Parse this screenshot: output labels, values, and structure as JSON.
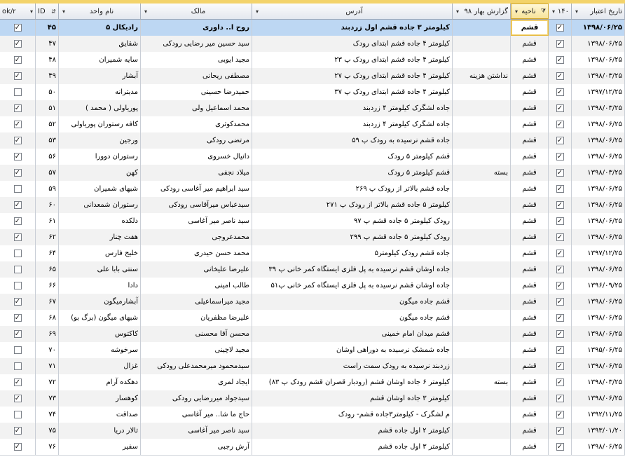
{
  "columns": {
    "ok": "ok/r",
    "id": "ID",
    "unit_name": "نام واحد",
    "owner": "مالک",
    "address": "آدرس",
    "report": "گزارش بهار ۹۸",
    "district": "ناحیه",
    "c140": "۱۴۰",
    "validity": "تاریخ اعتبار"
  },
  "icons": {
    "dropdown": "▾",
    "check": "✓",
    "filter": "filter-sort-icon"
  },
  "colors": {
    "selected_row": "#bdd7f3",
    "header_highlight": "#f7e39a",
    "top_bar": "#f3d36a"
  },
  "rows": [
    {
      "ok": true,
      "id": "۴۵",
      "unit": "رادیکال ۵",
      "owner": "روح ا.. داوری",
      "address": "کیلومتر ۳ جاده قشم اول زردبند",
      "report": "",
      "district": "قشم",
      "c140": true,
      "date": "۱۳۹۸/۰۶/۲۵",
      "selected": true
    },
    {
      "ok": true,
      "id": "۴۷",
      "unit": "شقایق",
      "owner": "سید حسین میر رضایی رودکی",
      "address": "کیلومتر ۴ جاده قشم ابتدای رودک",
      "report": "",
      "district": "قشم",
      "c140": true,
      "date": "۱۳۹۸/۰۶/۲۵"
    },
    {
      "ok": true,
      "id": "۴۸",
      "unit": "سایه شمیران",
      "owner": "مجید ایوبی",
      "address": "کیلومتر ۴ جاده قشم ابتدای رودک پ ۲۳",
      "report": "",
      "district": "قشم",
      "c140": true,
      "date": "۱۳۹۸/۰۶/۲۵"
    },
    {
      "ok": true,
      "id": "۴۹",
      "unit": "آبشار",
      "owner": "مصطفی ریحانی",
      "address": "کیلومتر ۴ جاده قشم ابتدای رودک پ ۲۷",
      "report": "نداشتن هزینه",
      "district": "قشم",
      "c140": true,
      "date": "۱۳۹۸/۰۳/۲۵"
    },
    {
      "ok": false,
      "id": "۵۰",
      "unit": "مدیترانه",
      "owner": "حمیدرضا حسینی",
      "address": "کیلومتر ۴ جاده قشم ابتدای رودک پ ۳۷",
      "report": "",
      "district": "قشم",
      "c140": true,
      "date": "۱۳۹۷/۱۲/۲۵"
    },
    {
      "ok": true,
      "id": "۵۱",
      "unit": "پوریاولی ( محمد )",
      "owner": "محمد اسماعیل ولی",
      "address": "جاده لشگرک کیلومتر ۴ زردبند",
      "report": "",
      "district": "قشم",
      "c140": true,
      "date": "۱۳۹۸/۰۳/۲۵"
    },
    {
      "ok": true,
      "id": "۵۲",
      "unit": "کافه رستوران پوریاولی",
      "owner": "محمدکوثری",
      "address": "جاده لشگرک کیلومتر ۴ زردبند",
      "report": "",
      "district": "قشم",
      "c140": true,
      "date": "۱۳۹۸/۰۶/۲۵"
    },
    {
      "ok": true,
      "id": "۵۳",
      "unit": "ورجین",
      "owner": "مرتضی رودکی",
      "address": "جاده قشم نرسیده به رودک پ ۵۹",
      "report": "",
      "district": "قشم",
      "c140": true,
      "date": "۱۳۹۸/۰۶/۲۵"
    },
    {
      "ok": true,
      "id": "۵۶",
      "unit": "رستوران دوورا",
      "owner": "دانیال خسروی",
      "address": "قشم کیلومتر ۵ رودک",
      "report": "",
      "district": "قشم",
      "c140": true,
      "date": "۱۳۹۸/۰۶/۲۵"
    },
    {
      "ok": true,
      "id": "۵۷",
      "unit": "کهن",
      "owner": "میلاد نجفی",
      "address": "قشم کیلومتر ۵ رودک",
      "report": "بسته",
      "district": "قشم",
      "c140": true,
      "date": "۱۳۹۸/۰۳/۲۵"
    },
    {
      "ok": false,
      "id": "۵۹",
      "unit": "شبهای شمیران",
      "owner": "سید ابراهیم میر آغاسی رودکی",
      "address": "جاده قشم بالاتر از رودک پ ۲۶۹",
      "report": "",
      "district": "قشم",
      "c140": true,
      "date": "۱۳۹۸/۰۶/۲۵"
    },
    {
      "ok": true,
      "id": "۶۰",
      "unit": "رستوران شمعدانی",
      "owner": "سیدعباس میرآقاسی رودکی",
      "address": "کیلومتر ۵ جاده قشم بالاتر از رودک پ ۲۷۱",
      "report": "",
      "district": "قشم",
      "c140": true,
      "date": "۱۳۹۸/۰۶/۲۵"
    },
    {
      "ok": true,
      "id": "۶۱",
      "unit": "دلکده",
      "owner": "سید ناصر میر آغاسی",
      "address": "رودک کیلومتر ۵ جاده قشم پ ۹۷",
      "report": "",
      "district": "قشم",
      "c140": true,
      "date": "۱۳۹۸/۰۶/۲۵"
    },
    {
      "ok": true,
      "id": "۶۲",
      "unit": "هفت چنار",
      "owner": "محمدعروجی",
      "address": "رودک کیلومتر ۵ جاده قشم پ ۲۹۹",
      "report": "",
      "district": "قشم",
      "c140": true,
      "date": "۱۳۹۸/۰۶/۲۵"
    },
    {
      "ok": false,
      "id": "۶۴",
      "unit": "خلیج فارس",
      "owner": "محمد حسن حیدری",
      "address": "جاده قشم رودک کیلومتر۵",
      "report": "",
      "district": "قشم",
      "c140": true,
      "date": "۱۳۹۷/۱۲/۲۵"
    },
    {
      "ok": false,
      "id": "۶۵",
      "unit": "سنتی بابا علی",
      "owner": "علیرضا علیخانی",
      "address": "جاده اوشان قشم نرسیده به پل فلزی ایستگاه کمر خانی پ ۳۹",
      "report": "",
      "district": "قشم",
      "c140": true,
      "date": "۱۳۹۸/۰۶/۲۵"
    },
    {
      "ok": false,
      "id": "۶۶",
      "unit": "دادا",
      "owner": "طالب امینی",
      "address": "جاده اوشان قشم نرسیده به پل فلزی ایستگاه کمر خانی پ۵۱",
      "report": "",
      "district": "قشم",
      "c140": true,
      "date": "۱۳۹۶/۰۹/۲۵"
    },
    {
      "ok": true,
      "id": "۶۷",
      "unit": "آبشارمیگون",
      "owner": "مجید میراسماعیلی",
      "address": "قشم جاده میگون",
      "report": "",
      "district": "قشم",
      "c140": true,
      "date": "۱۳۹۸/۰۶/۲۵"
    },
    {
      "ok": true,
      "id": "۶۸",
      "unit": "شبهای میگون (برگ بو)",
      "owner": "علیرضا مظفریان",
      "address": "قشم جاده میگون",
      "report": "",
      "district": "قشم",
      "c140": true,
      "date": "۱۳۹۸/۰۶/۲۵"
    },
    {
      "ok": true,
      "id": "۶۹",
      "unit": "کاکتوس",
      "owner": "محسن آقا محسنی",
      "address": "قشم میدان امام خمینی",
      "report": "",
      "district": "قشم",
      "c140": true,
      "date": "۱۳۹۸/۰۶/۲۵"
    },
    {
      "ok": false,
      "id": "۷۰",
      "unit": "سرخوشه",
      "owner": "مجید لاچینی",
      "address": "جاده شمشک نرسیده به دوراهی اوشان",
      "report": "",
      "district": "قشم",
      "c140": true,
      "date": "۱۳۹۵/۰۶/۲۵"
    },
    {
      "ok": false,
      "id": "۷۱",
      "unit": "غزال",
      "owner": "سیدمحمود میرمحمدعلی رودکی",
      "address": "زردبند نرسیده به رودک سمت راست",
      "report": "",
      "district": "قشم",
      "c140": true,
      "date": "۱۳۹۸/۰۶/۲۵"
    },
    {
      "ok": true,
      "id": "۷۲",
      "unit": "دهکده آرام",
      "owner": "ایجاد لمری",
      "address": "کیلومتر ۶ جاده اوشان قشم (رودبار قصران قشم رودک پ ۸۳)",
      "report": "بسته",
      "district": "قشم",
      "c140": true,
      "date": "۱۳۹۸/۰۳/۲۵"
    },
    {
      "ok": true,
      "id": "۷۳",
      "unit": "کوهسار",
      "owner": "سیدجواد میررضایی رودکی",
      "address": "کیلومتر ۳ جاده اوشان قشم",
      "report": "",
      "district": "قشم",
      "c140": true,
      "date": "۱۳۹۸/۰۶/۲۵"
    },
    {
      "ok": false,
      "id": "۷۴",
      "unit": "صداقت",
      "owner": "حاج ما شا.. میر آغاسی",
      "address": "م لشگرک - کیلومتر۳جاده قشم- رودک",
      "report": "",
      "district": "قشم",
      "c140": true,
      "date": "۱۳۹۲/۱۱/۲۵"
    },
    {
      "ok": true,
      "id": "۷۵",
      "unit": "تالار دریا",
      "owner": "سید ناصر میر آغاسی",
      "address": "کیلومتر ۲ اول جاده قشم",
      "report": "",
      "district": "قشم",
      "c140": true,
      "date": "۱۳۹۳/۰۱/۲۰"
    },
    {
      "ok": true,
      "id": "۷۶",
      "unit": "سفیر",
      "owner": "آرش رجبی",
      "address": "کیلومتر ۳ اول جاده قشم",
      "report": "",
      "district": "قشم",
      "c140": true,
      "date": "۱۳۹۸/۰۶/۲۵"
    }
  ]
}
